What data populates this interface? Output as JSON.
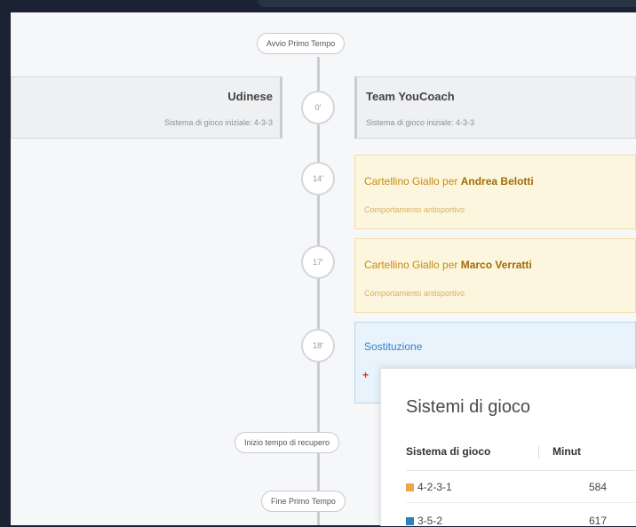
{
  "timeline": {
    "start_label": "Avvio Primo Tempo",
    "kickoff_minute": "0'",
    "home": {
      "name": "Udinese",
      "system": "Sistema di gioco iniziale: 4-3-3"
    },
    "away": {
      "name": "Team YouCoach",
      "system": "Sistema di gioco iniziale: 4-3-3"
    },
    "events": [
      {
        "minute": "14'",
        "title_prefix": "Cartellino Giallo per ",
        "player": "Andrea Belotti",
        "detail": "Comportamento antisportivo"
      },
      {
        "minute": "17'",
        "title_prefix": "Cartellino Giallo per ",
        "player": "Marco Verratti",
        "detail": "Comportamento antisportivo"
      },
      {
        "minute": "18'",
        "title": "Sostituzione"
      }
    ],
    "stoppage_label": "Inizio tempo di recupero",
    "end_label": "Fine Primo Tempo"
  },
  "popup": {
    "title": "Sistemi di gioco",
    "col1": "Sistema di gioco",
    "col2": "Minut",
    "rows": [
      {
        "system": "4-2-3-1",
        "minutes": "584",
        "color": "#e9a849"
      },
      {
        "system": "3-5-2",
        "minutes": "617",
        "color": "#2f7fc1"
      }
    ]
  },
  "colors": {
    "yellow_card_bg": "#fdf6de",
    "substitution_bg": "#e9f3fb"
  }
}
